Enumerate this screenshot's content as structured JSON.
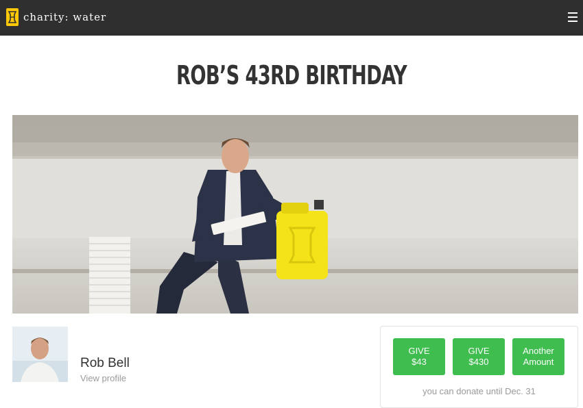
{
  "header": {
    "brand_name": "charity: water",
    "logo_icon": "jerrycan-logo-icon",
    "menu_icon": "hamburger-menu-icon",
    "background_color": "#2f2f2f",
    "logo_color": "#ffc907"
  },
  "campaign": {
    "title": "ROB’S 43RD BIRTHDAY"
  },
  "profile": {
    "name": "Rob Bell",
    "link_label": "View profile"
  },
  "donate": {
    "buttons": [
      {
        "line1": "GIVE",
        "line2": "$43"
      },
      {
        "line1": "GIVE",
        "line2": "$430"
      },
      {
        "line1": "Another",
        "line2": "Amount"
      }
    ],
    "deadline": "you can donate until Dec. 31",
    "button_color": "#3fbd4f"
  }
}
